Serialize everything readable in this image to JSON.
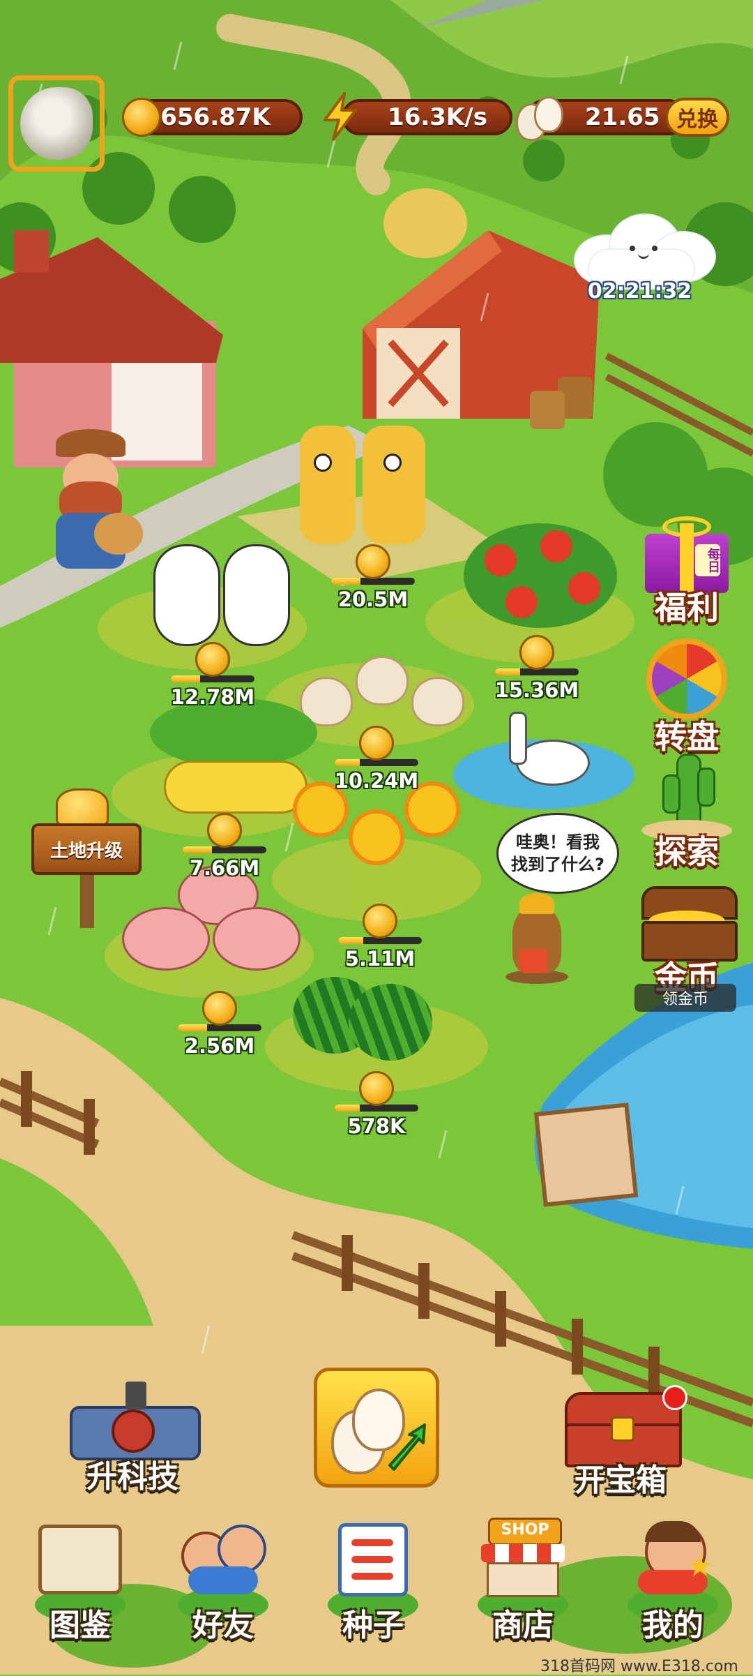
{
  "hud": {
    "coins": "656.87K",
    "rate": "16.3K/s",
    "eggs": "21.65",
    "exchange_label": "兑换",
    "timer": "02:21:32"
  },
  "plots": [
    {
      "label": "20.5M",
      "progress": 0.35
    },
    {
      "label": "15.36M",
      "progress": 0.3
    },
    {
      "label": "12.78M",
      "progress": 0.35
    },
    {
      "label": "10.24M",
      "progress": 0.3
    },
    {
      "label": "7.66M",
      "progress": 0.35
    },
    {
      "label": "5.11M",
      "progress": 0.3
    },
    {
      "label": "2.56M",
      "progress": 0.35
    },
    {
      "label": "578K",
      "progress": 0.3
    }
  ],
  "land_upgrade_sign": "土地升级",
  "mole_bubble": "哇奥！看我找到了什么?",
  "side_menu": {
    "welfare": "福利",
    "welfare_badge": "每日",
    "wheel": "转盘",
    "explore": "探索",
    "gold": "金币",
    "gold_sub": "领金币"
  },
  "actions": {
    "upgrade_tech": "升科技",
    "open_chest": "开宝箱"
  },
  "nav": [
    {
      "label": "图鉴",
      "icon": "book-icon"
    },
    {
      "label": "好友",
      "icon": "friends-icon"
    },
    {
      "label": "种子",
      "icon": "seeds-icon"
    },
    {
      "label": "商店",
      "icon": "shop-icon"
    },
    {
      "label": "我的",
      "icon": "profile-icon"
    }
  ],
  "shop_sign": "SHOP",
  "watermark": "318首码网 www.E318.com",
  "colors": {
    "grass": "#7cc63a",
    "path": "#e7c98a",
    "pond": "#3aa0d8",
    "accent": "#f2a31c"
  }
}
